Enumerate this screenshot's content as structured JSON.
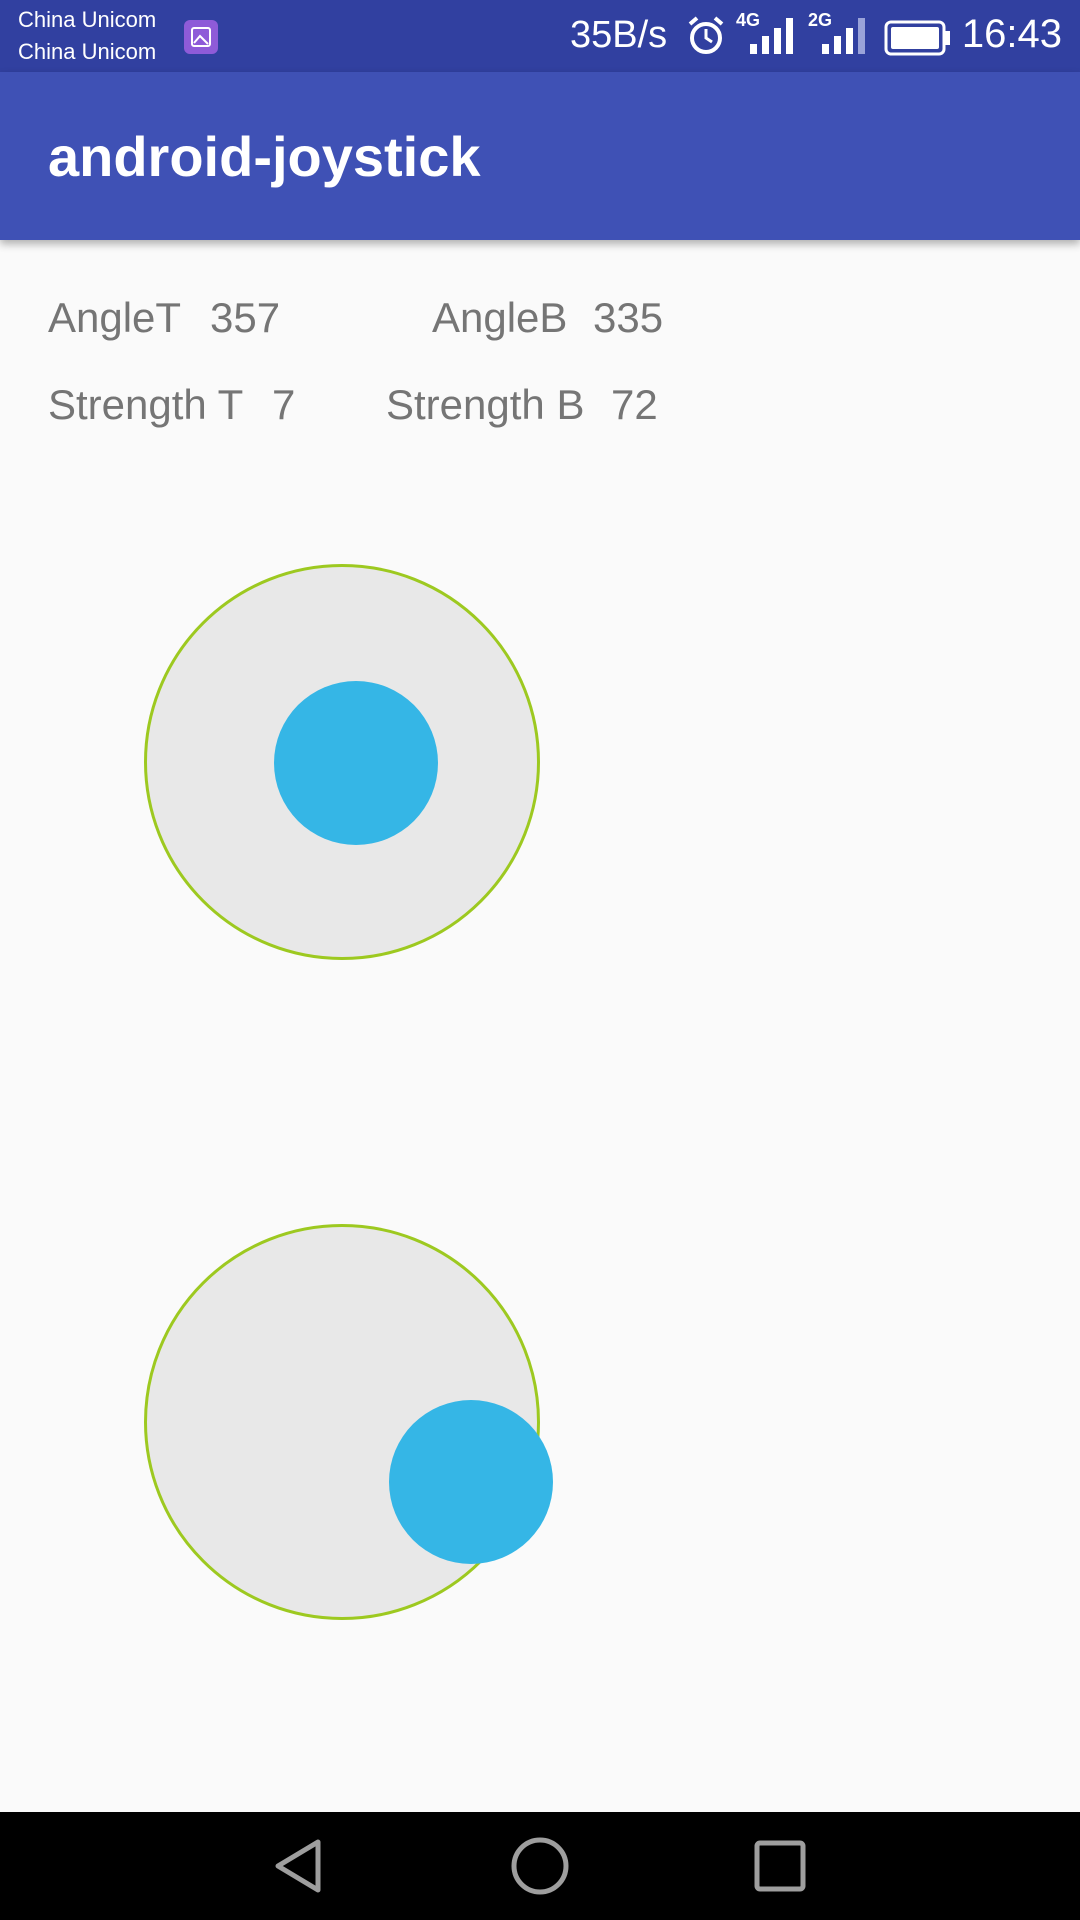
{
  "status_bar": {
    "carrier_1": "China Unicom",
    "carrier_2": "China Unicom",
    "net_speed": "35B/s",
    "network_1": "4G",
    "network_2": "2G",
    "time": "16:43",
    "icons": [
      "image-notification-icon",
      "alarm-icon",
      "signal-4g-icon",
      "signal-2g-icon",
      "battery-icon"
    ]
  },
  "app_bar": {
    "title": "android-joystick",
    "color": "#3f51b5"
  },
  "readouts": {
    "angle_top_label": "AngleT",
    "angle_top_value": "357",
    "angle_bottom_label": "AngleB",
    "angle_bottom_value": "335",
    "strength_top_label": "Strength T",
    "strength_top_value": "7",
    "strength_bottom_label": "Strength B",
    "strength_bottom_value": "72"
  },
  "joysticks": {
    "top": {
      "angle": 357,
      "strength": 7
    },
    "bottom": {
      "angle": 335,
      "strength": 72
    },
    "colors": {
      "base": "#e8e8e8",
      "border": "#9dc920",
      "knob": "#35b6e6"
    }
  },
  "nav_bar": {
    "icons": [
      "back-icon",
      "home-icon",
      "recents-icon"
    ]
  }
}
